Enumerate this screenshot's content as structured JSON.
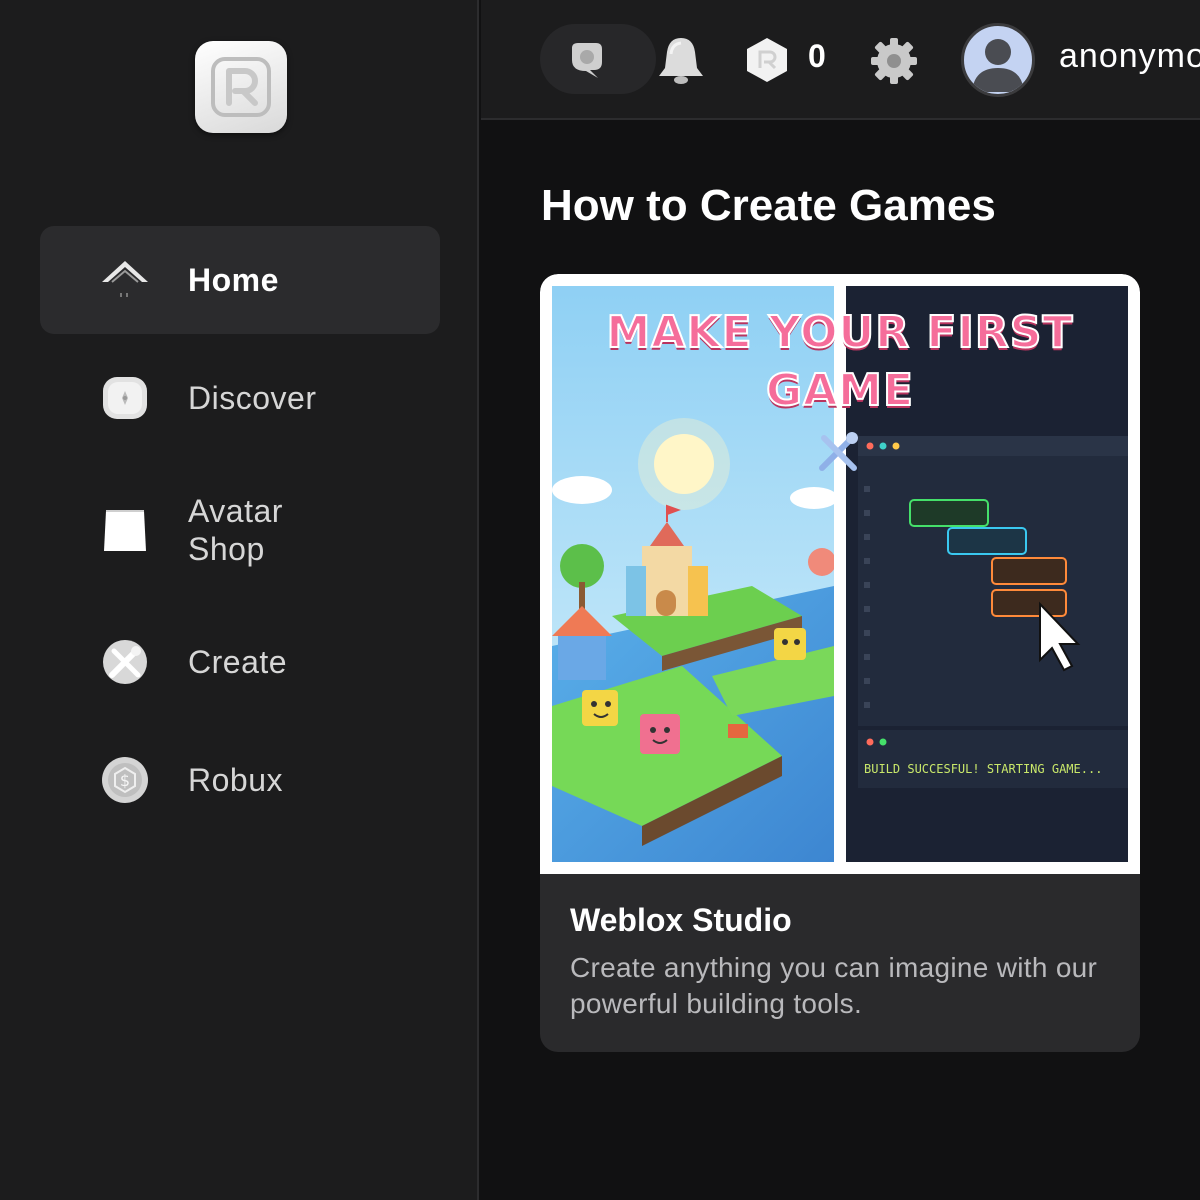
{
  "sidebar": {
    "items": [
      {
        "label": "Home",
        "icon": "home-icon",
        "active": true
      },
      {
        "label": "Discover",
        "icon": "discover-icon",
        "active": false
      },
      {
        "label": "Avatar\nShop",
        "icon": "avatar-shop-icon",
        "active": false
      },
      {
        "label": "Create",
        "icon": "create-icon",
        "active": false
      },
      {
        "label": "Robux",
        "icon": "robux-icon",
        "active": false
      }
    ]
  },
  "topbar": {
    "search_icon": "search-icon",
    "bell_icon": "bell-icon",
    "robux_icon": "robux-icon",
    "robux_count": "0",
    "settings_icon": "gear-icon",
    "username": "anonymous"
  },
  "main": {
    "title": "How to Create Games",
    "card": {
      "banner_text": "MAKE YOUR FIRST GAME",
      "console_text": "BUILD SUCCESFUL! STARTING GAME...",
      "title": "Weblox Studio",
      "description": "Create anything you can imagine with our powerful building tools."
    }
  },
  "colors": {
    "background": "#111112",
    "sidebar": "#1c1c1d",
    "active_item": "#2b2b2d",
    "card": "#2a2a2c"
  }
}
